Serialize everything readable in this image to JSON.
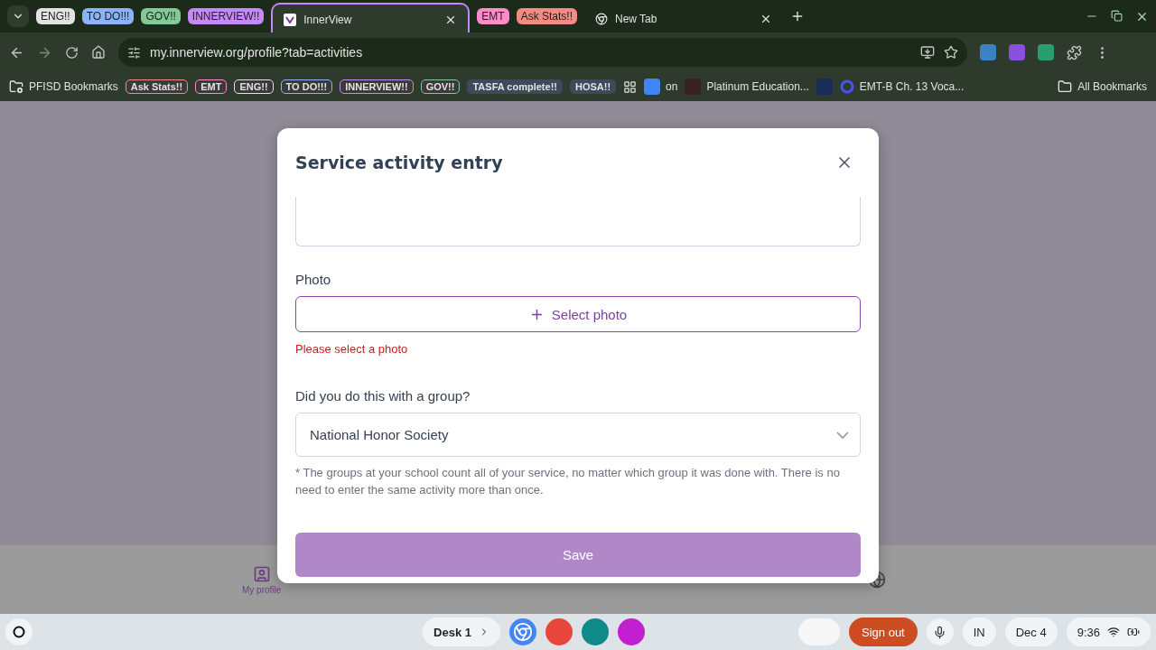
{
  "tab_strip": [
    {
      "kind": "group",
      "label": "ENG!!",
      "color": "#e3e3e3"
    },
    {
      "kind": "group",
      "label": "TO DO!!!",
      "color": "#8ab4f8"
    },
    {
      "kind": "group",
      "label": "GOV!!",
      "color": "#81c995"
    },
    {
      "kind": "group",
      "label": "INNERVIEW!!",
      "color": "#c58af9"
    },
    {
      "kind": "tab",
      "title": "InnerView",
      "selected": true
    },
    {
      "kind": "group",
      "label": "EMT",
      "color": "#ff8bcb"
    },
    {
      "kind": "group",
      "label": "Ask Stats!!",
      "color": "#f28b82"
    },
    {
      "kind": "tab",
      "title": "New Tab",
      "selected": false
    }
  ],
  "address_bar": {
    "url": "my.innerview.org/profile?tab=activities"
  },
  "bookmarks": [
    {
      "kind": "folder",
      "label": "PFISD Bookmarks"
    },
    {
      "kind": "group",
      "label": "Ask Stats!!",
      "color": "#f28b82"
    },
    {
      "kind": "group",
      "label": "EMT",
      "color": "#ff8bcb"
    },
    {
      "kind": "group",
      "label": "ENG!!",
      "color": "#e3e3e3"
    },
    {
      "kind": "group",
      "label": "TO DO!!!",
      "color": "#8ab4f8"
    },
    {
      "kind": "group",
      "label": "INNERVIEW!!",
      "color": "#c58af9"
    },
    {
      "kind": "group",
      "label": "GOV!!",
      "color": "#81c995"
    },
    {
      "kind": "chip",
      "label": "TASFA complete!!"
    },
    {
      "kind": "chip",
      "label": "HOSA!!"
    },
    {
      "kind": "apps"
    },
    {
      "kind": "doc",
      "label": "on"
    },
    {
      "kind": "platinum",
      "label": "Platinum Education..."
    },
    {
      "kind": "star"
    },
    {
      "kind": "quizlet",
      "label": "EMT-B Ch. 13 Voca..."
    }
  ],
  "all_bookmarks": "All Bookmarks",
  "dialog": {
    "title": "Service activity entry",
    "photo_label": "Photo",
    "select_photo": "Select photo",
    "photo_error": "Please select a photo",
    "group_label": "Did you do this with a group?",
    "group_value": "National Honor Society",
    "note": "* The groups at your school count all of your service, no matter which group it was done with. There is no need to enter the same activity more than once.",
    "save": "Save"
  },
  "page_nav": {
    "label": "My profile"
  },
  "shelf": {
    "desk": "Desk 1",
    "sign_out": "Sign out",
    "ime": "IN",
    "date": "Dec 4",
    "time": "9:36"
  }
}
